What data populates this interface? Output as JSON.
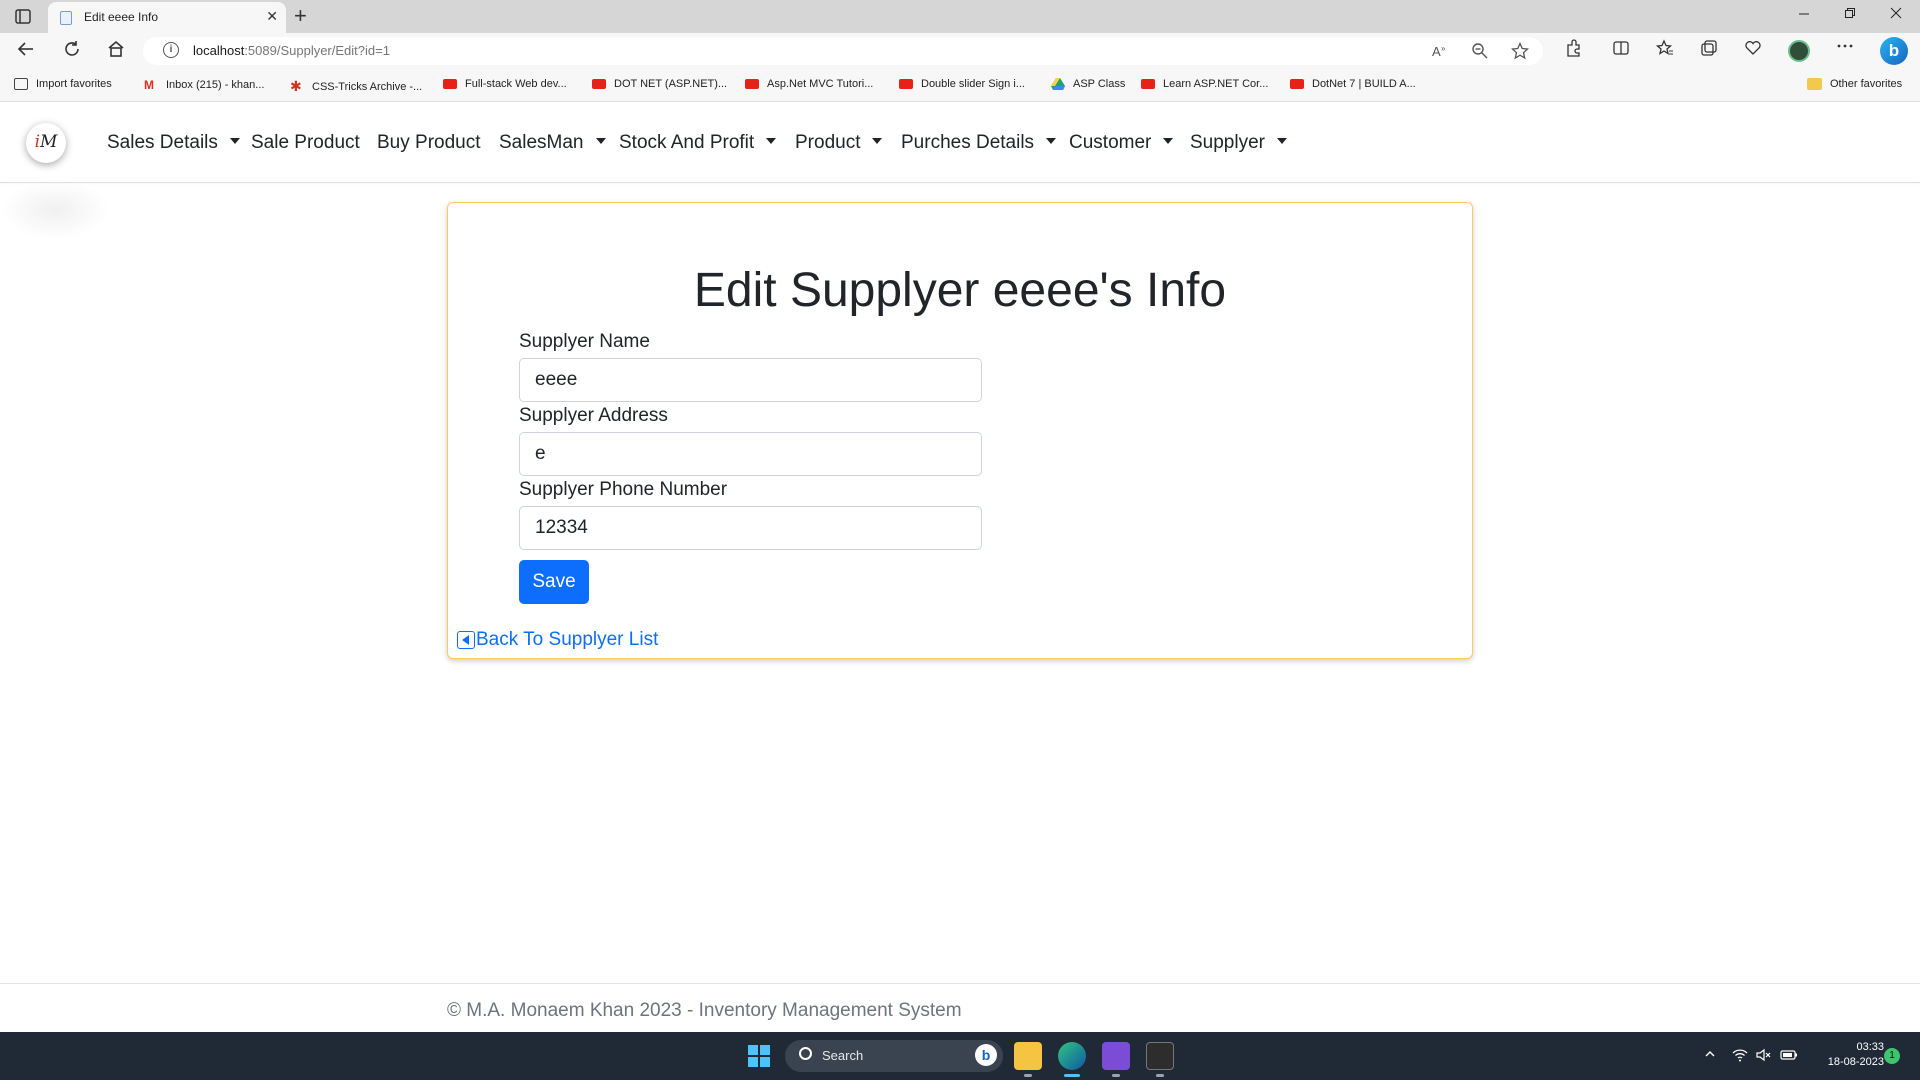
{
  "browser": {
    "tab_title": "Edit eeee Info",
    "tab_close": "✕",
    "new_tab": "+",
    "url_host": "localhost",
    "url_path": ":5089/Supplyer/Edit?id=1",
    "bookmarks": [
      {
        "label": "Import favorites",
        "icon": "import-icon"
      },
      {
        "label": "Inbox (215) - khan...",
        "icon": "gmail-icon"
      },
      {
        "label": "CSS-Tricks Archive -...",
        "icon": "css-tricks-icon"
      },
      {
        "label": "Full-stack Web dev...",
        "icon": "youtube-icon"
      },
      {
        "label": "DOT NET (ASP.NET)...",
        "icon": "youtube-icon"
      },
      {
        "label": "Asp.Net MVC Tutori...",
        "icon": "youtube-icon"
      },
      {
        "label": "Double slider Sign i...",
        "icon": "youtube-icon"
      },
      {
        "label": "ASP Class",
        "icon": "drive-icon"
      },
      {
        "label": "Learn ASP.NET Cor...",
        "icon": "youtube-icon"
      },
      {
        "label": "DotNet 7 | BUILD A...",
        "icon": "youtube-icon"
      }
    ],
    "other_favorites": "Other favorites"
  },
  "navbar": {
    "logo_text": "iM",
    "items": [
      {
        "label": "Sales Details",
        "dropdown": true
      },
      {
        "label": "Sale Product",
        "dropdown": false
      },
      {
        "label": "Buy Product",
        "dropdown": false
      },
      {
        "label": "SalesMan",
        "dropdown": true
      },
      {
        "label": "Stock And Profit",
        "dropdown": true
      },
      {
        "label": "Product",
        "dropdown": true
      },
      {
        "label": "Purches Details",
        "dropdown": true
      },
      {
        "label": "Customer",
        "dropdown": true
      },
      {
        "label": "Supplyer",
        "dropdown": true
      }
    ]
  },
  "form": {
    "title": "Edit Supplyer eeee's Info",
    "fields": [
      {
        "label": "Supplyer Name",
        "value": "eeee"
      },
      {
        "label": "Supplyer Address",
        "value": "e"
      },
      {
        "label": "Supplyer Phone Number",
        "value": "12334"
      }
    ],
    "save_label": "Save",
    "back_label": "Back To Supplyer List"
  },
  "footer": {
    "text": "© M.A. Monaem Khan 2023 - Inventory Management System"
  },
  "taskbar": {
    "search_label": "Search",
    "time": "03:33",
    "date": "18-08-2023",
    "notification_count": "1"
  },
  "colors": {
    "primary": "#0d6efd",
    "card_border": "#f0d060",
    "taskbar": "#1f2a36"
  }
}
